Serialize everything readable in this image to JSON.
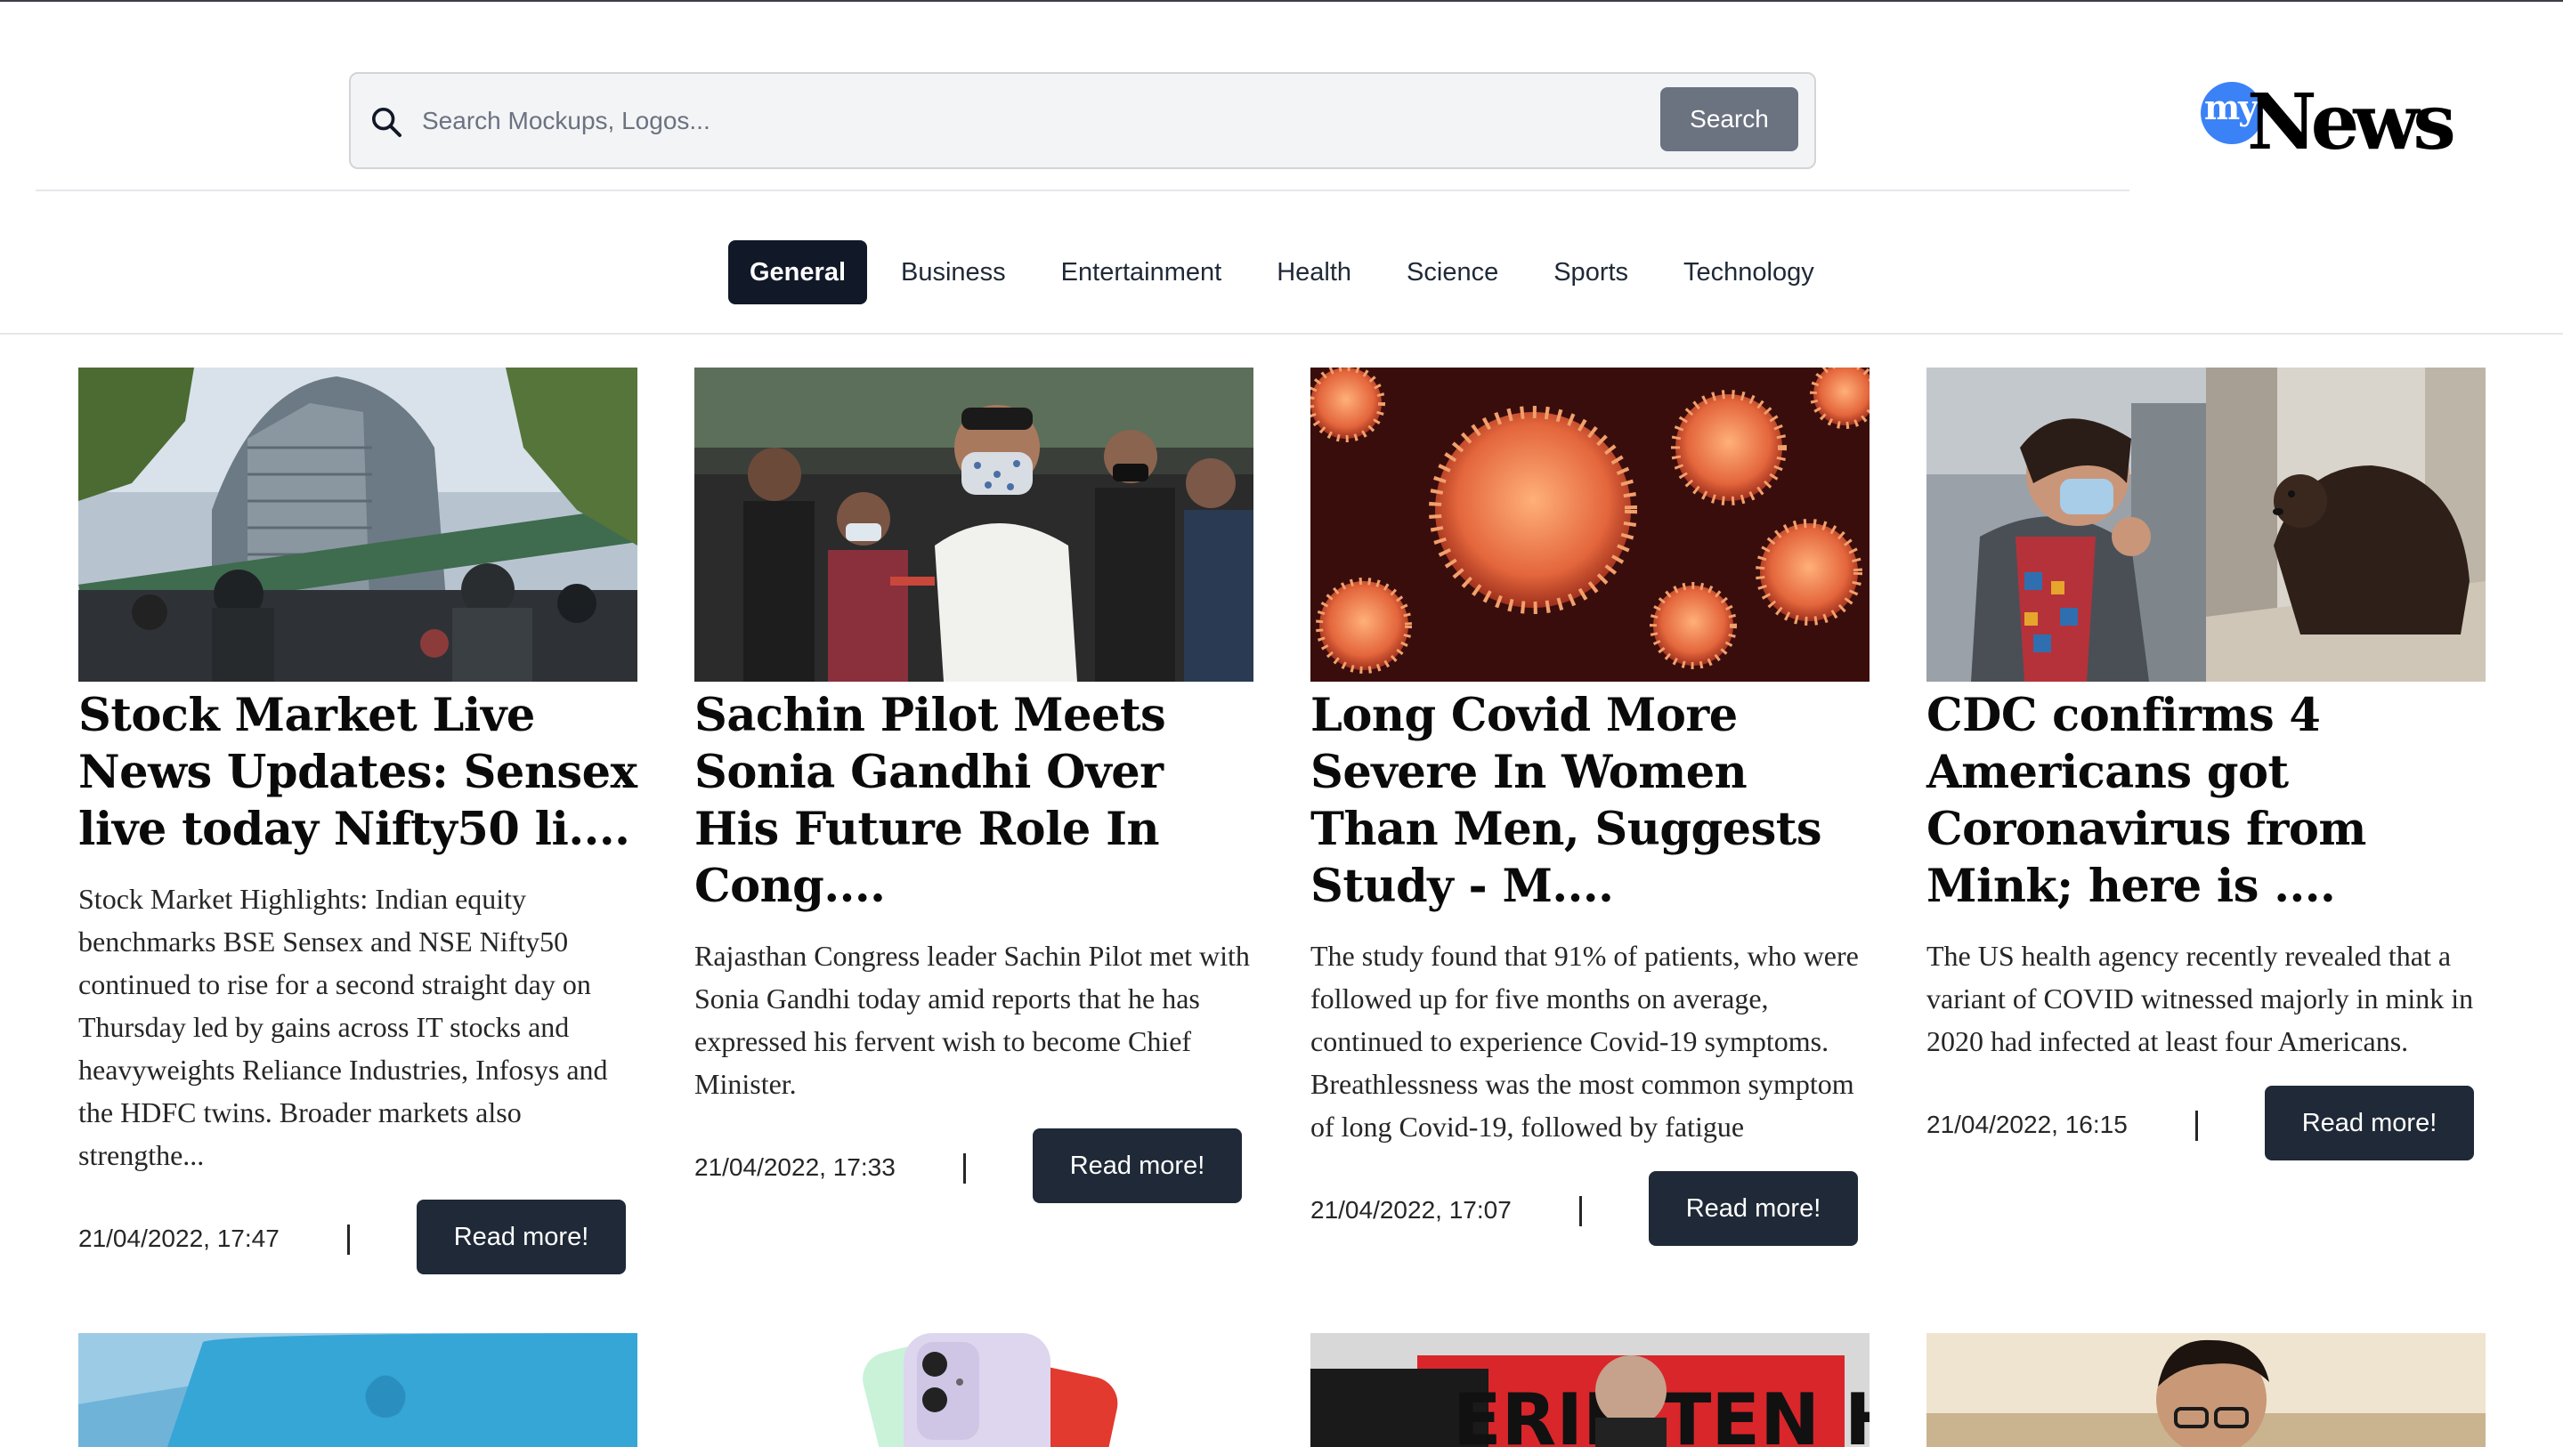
{
  "search": {
    "placeholder": "Search Mockups, Logos...",
    "button_label": "Search"
  },
  "logo": {
    "my": "my",
    "news": "News"
  },
  "categories": [
    "General",
    "Business",
    "Entertainment",
    "Health",
    "Science",
    "Sports",
    "Technology"
  ],
  "active_category": "General",
  "articles": [
    {
      "title": "Stock Market Live News Updates: Sensex live today Nifty50 li....",
      "description": "Stock Market Highlights: Indian equity benchmarks BSE Sensex and NSE Nifty50 continued to rise for a second straight day on Thursday led by gains across IT stocks and heavyweights Reliance Industries, Infosys and the HDFC twins. Broader markets also strengthe...",
      "date": "21/04/2022, 17:47",
      "button": "Read more!"
    },
    {
      "title": "Sachin Pilot Meets Sonia Gandhi Over His Future Role In Cong....",
      "description": "Rajasthan Congress leader Sachin Pilot met with Sonia Gandhi today amid reports that he has expressed his fervent wish to become Chief Minister.",
      "date": "21/04/2022, 17:33",
      "button": "Read more!"
    },
    {
      "title": "Long Covid More Severe In Women Than Men, Suggests Study - M....",
      "description": "The study found that 91% of patients, who were followed up for five months on average, continued to experience Covid-19 symptoms. Breathlessness was the most common symptom of long Covid-19, followed by fatigue",
      "date": "21/04/2022, 17:07",
      "button": "Read more!"
    },
    {
      "title": "CDC confirms 4 Americans got Coronavirus from Mink; here is ....",
      "description": "The US health agency recently revealed that a variant of COVID witnessed majorly in mink in 2020 had infected at least four Americans.",
      "date": "21/04/2022, 16:15",
      "button": "Read more!"
    }
  ],
  "bottom_thumbs": [
    "blue-phone-image",
    "iphones-image",
    "erik-ten-hag-poster-image",
    "man-portrait-image"
  ],
  "colors": {
    "active_tab": "#111827",
    "search_button": "#6b7280",
    "read_more": "#1f2937",
    "logo_accent": "#3b82f6"
  }
}
